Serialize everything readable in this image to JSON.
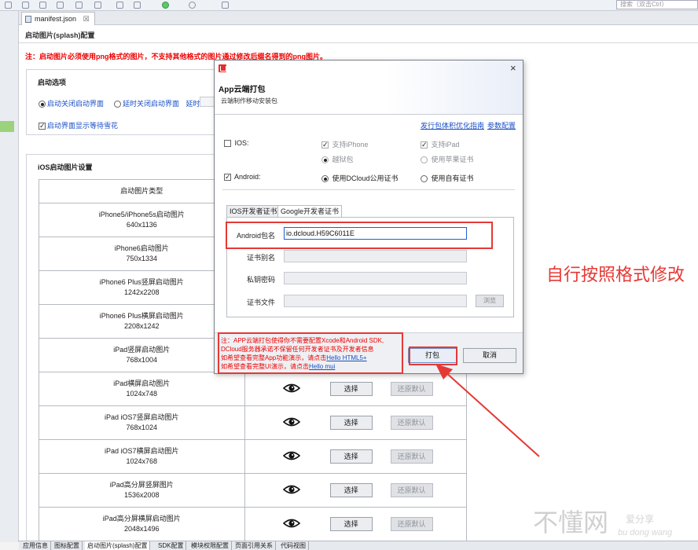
{
  "toolbar": {
    "search_placeholder": "搜索（双击Ctrl）"
  },
  "editor_tab": {
    "label": "manifest.json",
    "close": "☒"
  },
  "page": {
    "title": "启动图片(splash)配置",
    "note": "注：启动图片必须使用png格式的图片，不支持其他格式的图片通过修改后缀名得到的png图片。"
  },
  "splash_options": {
    "title": "启动选项",
    "radio_auto_close": "启动关闭启动界面",
    "radio_delay_close": "延时关闭启动界面",
    "delay_label": "延时",
    "check_waiting": "启动界面显示等待雪花"
  },
  "ios_section": {
    "title": "iOS启动图片设置",
    "header_type": "启动图片类型",
    "select_label": "选择",
    "default_label": "还原默认",
    "rows": [
      {
        "name": "iPhone5/iPhone5s启动图片",
        "size": "640x1136"
      },
      {
        "name": "iPhone6启动图片",
        "size": "750x1334"
      },
      {
        "name": "iPhone6 Plus竖屏启动图片",
        "size": "1242x2208"
      },
      {
        "name": "iPhone6 Plus横屏启动图片",
        "size": "2208x1242"
      },
      {
        "name": "iPad竖屏启动图片",
        "size": "768x1004"
      },
      {
        "name": "iPad横屏启动图片",
        "size": "1024x748"
      },
      {
        "name": "iPad iOS7竖屏启动图片",
        "size": "768x1024"
      },
      {
        "name": "iPad iOS7横屏启动图片",
        "size": "1024x768"
      },
      {
        "name": "iPad高分屏竖屏图片",
        "size": "1536x2008"
      },
      {
        "name": "iPad高分屏横屏启动图片",
        "size": "2048x1496"
      }
    ]
  },
  "bottom_tabs": [
    "应用信息",
    "图标配置",
    "启动图片(splash)配置",
    "SDK配置",
    "模块权限配置",
    "页面引用关系",
    "代码视图"
  ],
  "dialog": {
    "title": "App云端打包",
    "subtitle": "云端制作移动安装包",
    "close": "×",
    "link_optimize": "发行包体积优化指南",
    "link_params": "参数配置",
    "ios_label": "IOS:",
    "support_iphone": "支持iPhone",
    "support_ipad": "支持iPad",
    "jailbreak": "越狱包",
    "use_apple_cert": "使用苹果证书",
    "android_label": "Android:",
    "use_dcloud_cert": "使用DCloud公用证书",
    "use_own_cert": "使用自有证书",
    "tab_ios_cert": "IOS开发者证书",
    "tab_google_cert": "Google开发者证书",
    "pkg_label": "Android包名",
    "pkg_value": "io.dcloud.H59C6011E",
    "alias_label": "证书别名",
    "key_label": "私钥密码",
    "file_label": "证书文件",
    "browse": "浏览",
    "footer_note_1": "注：APP云端打包使得你不需要配置Xcode和Android SDK,",
    "footer_note_2": "DCloud服务器承诺不保留任何开发者证书及开发者信息",
    "footer_note_3": "如希望查看完整App功能演示，请点击",
    "footer_link_1": "Hello HTML5+",
    "footer_note_4": "如希望查看完整UI演示，请点击",
    "footer_link_2": "Hello mui",
    "pack_button": "打包",
    "cancel_button": "取消"
  },
  "annotation": {
    "text": "自行按照格式修改"
  },
  "watermark": {
    "big": "不懂网",
    "small": "爱分享",
    "pinyin": "bu dong wang"
  },
  "colors": {
    "annotation_red": "#e53935",
    "link_blue": "#1a4fc4",
    "note_red": "#ee0000"
  }
}
